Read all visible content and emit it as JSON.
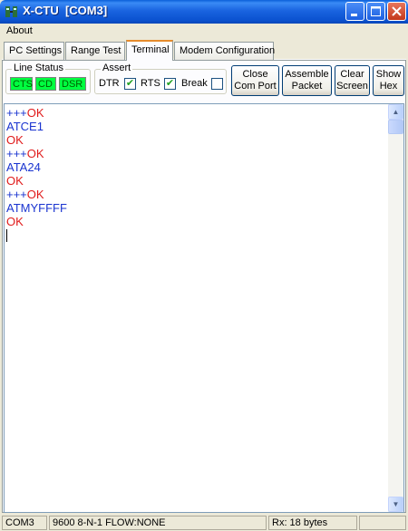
{
  "window": {
    "title": "X-CTU  [COM3]"
  },
  "menu": {
    "items": [
      "About"
    ]
  },
  "tabs": [
    "PC Settings",
    "Range Test",
    "Terminal",
    "Modem Configuration"
  ],
  "active_tab": "Terminal",
  "line_status": {
    "title": "Line Status",
    "leds": [
      "CTS",
      "CD",
      "DSR"
    ],
    "led_color": "#00ff40"
  },
  "assert": {
    "title": "Assert",
    "dtr": {
      "label": "DTR",
      "checked": true
    },
    "rts": {
      "label": "RTS",
      "checked": true
    },
    "brk": {
      "label": "Break",
      "checked": false
    }
  },
  "buttons": {
    "close_port": [
      "Close",
      "Com Port"
    ],
    "assemble": [
      "Assemble",
      "Packet"
    ],
    "clear": [
      "Clear",
      "Screen"
    ],
    "hex": [
      "Show",
      "Hex"
    ]
  },
  "terminal": {
    "lines": [
      {
        "parts": [
          {
            "text": "+++",
            "color": "blue"
          },
          {
            "text": "OK",
            "color": "red"
          }
        ]
      },
      {
        "parts": [
          {
            "text": "ATCE1",
            "color": "blue"
          }
        ]
      },
      {
        "parts": [
          {
            "text": "OK",
            "color": "red"
          }
        ]
      },
      {
        "parts": [
          {
            "text": "+++",
            "color": "blue"
          },
          {
            "text": "OK",
            "color": "red"
          }
        ]
      },
      {
        "parts": [
          {
            "text": "ATA24",
            "color": "blue"
          }
        ]
      },
      {
        "parts": [
          {
            "text": "OK",
            "color": "red"
          }
        ]
      },
      {
        "parts": [
          {
            "text": "+++",
            "color": "blue"
          },
          {
            "text": "OK",
            "color": "red"
          }
        ]
      },
      {
        "parts": [
          {
            "text": "ATMYFFFF",
            "color": "blue"
          }
        ]
      },
      {
        "parts": [
          {
            "text": "OK",
            "color": "red"
          }
        ]
      }
    ],
    "tx_color": "#1a34d0",
    "rx_color": "#e01a1a"
  },
  "status": {
    "port": "COM3",
    "settings": "9600 8-N-1  FLOW:NONE",
    "rx": "Rx: 18 bytes",
    "extra": ""
  }
}
